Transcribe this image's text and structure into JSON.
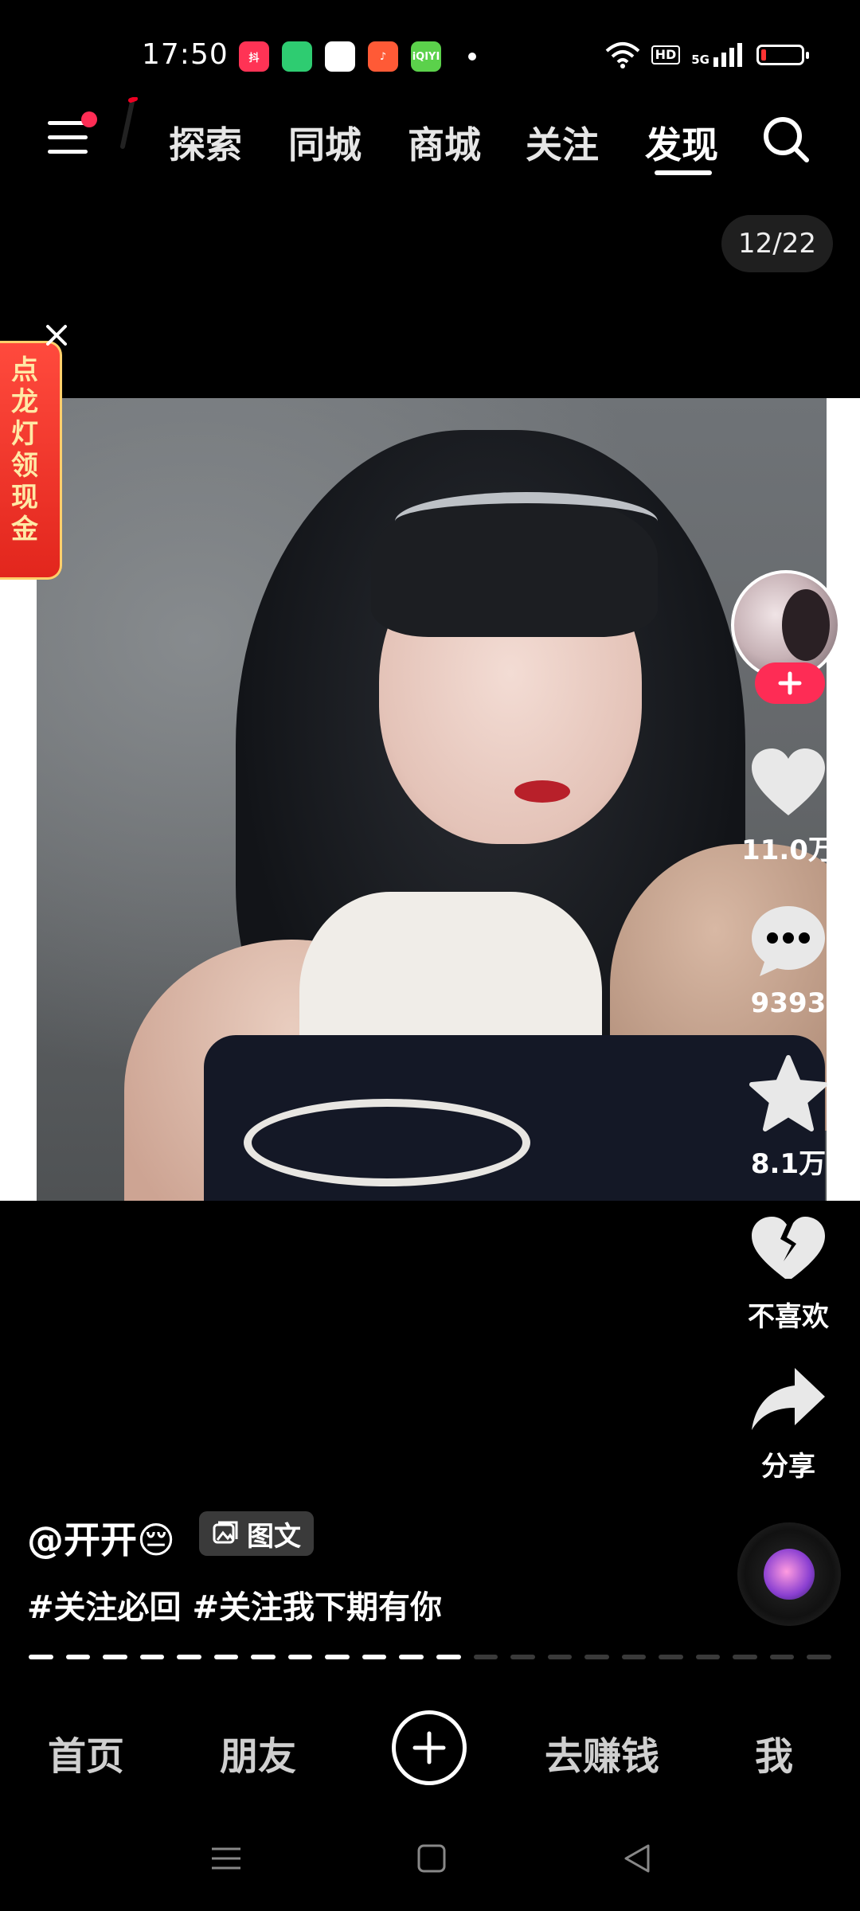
{
  "status_bar": {
    "time": "17:50",
    "app_icons": [
      {
        "name": "douyin-lite-icon",
        "color": "#ff3355",
        "text": "抖"
      },
      {
        "name": "battery-app-icon",
        "color": "#2ecc71",
        "text": ""
      },
      {
        "name": "wallet-app-icon",
        "color": "#ffffff",
        "text": ""
      },
      {
        "name": "music-app-icon",
        "color": "#ff5a36",
        "text": "♪"
      },
      {
        "name": "iqiyi-icon",
        "color": "#5bd14b",
        "text": "iQIYI"
      }
    ],
    "hd_label": "HD",
    "network_label": "5G"
  },
  "top_nav": {
    "tabs": [
      "探索",
      "同城",
      "商城",
      "关注",
      "发现"
    ],
    "active_tab": "发现"
  },
  "counter": "12/22",
  "promo": {
    "text": "点龙灯领现金"
  },
  "right_rail": {
    "likes": "11.0万",
    "comments": "9393",
    "favorites": "8.1万",
    "dislike_label": "不喜欢",
    "share_label": "分享"
  },
  "caption": {
    "author": "@开开😔",
    "badge": "图文",
    "tags": "#关注必回 #关注我下期有你"
  },
  "progress": {
    "total_segments": 22,
    "current": 12
  },
  "bottom_nav": {
    "home": "首页",
    "friends": "朋友",
    "earn": "去赚钱",
    "me": "我"
  },
  "colors": {
    "accent": "#fe2c55",
    "background": "#000000"
  }
}
